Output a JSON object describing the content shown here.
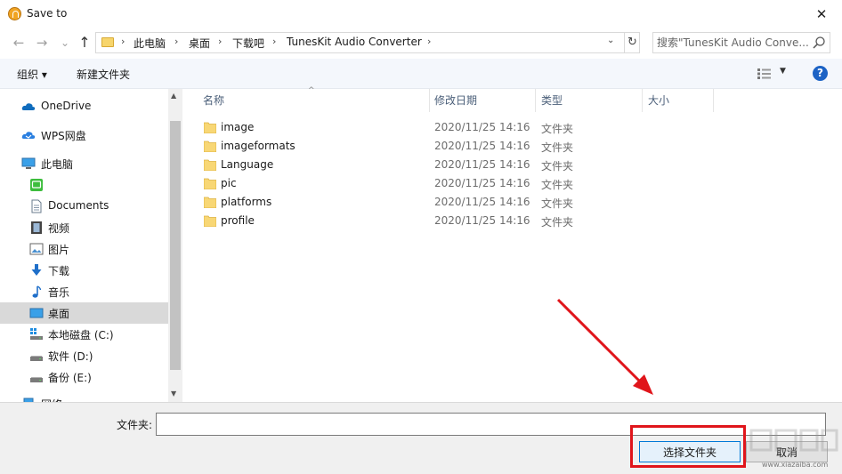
{
  "window": {
    "title": "Save to",
    "close_glyph": "✕"
  },
  "navigation": {
    "back_glyph": "←",
    "forward_glyph": "→",
    "recent_glyph": "⌄",
    "up_glyph": "↑",
    "breadcrumbs": [
      "此电脑",
      "桌面",
      "下载吧",
      "TunesKit Audio Converter"
    ],
    "crumb_separator": "›",
    "dropdown_glyph": "⌄",
    "refresh_glyph": "↻",
    "search_placeholder": "搜索\"TunesKit Audio Conve..."
  },
  "toolbar": {
    "organize_label": "组织 ▾",
    "new_folder_label": "新建文件夹",
    "view_dropdown_glyph": "▼",
    "help_label": "?"
  },
  "sidebar": {
    "items": [
      {
        "label": "OneDrive",
        "icon": "cloud-icon"
      },
      {
        "label": "WPS网盘",
        "icon": "wps-cloud-icon"
      },
      {
        "label": "此电脑",
        "icon": "computer-icon"
      },
      {
        "label": "",
        "icon": "wechat-files-icon"
      },
      {
        "label": "Documents",
        "icon": "document-icon"
      },
      {
        "label": "视频",
        "icon": "video-icon"
      },
      {
        "label": "图片",
        "icon": "picture-icon"
      },
      {
        "label": "下载",
        "icon": "download-icon"
      },
      {
        "label": "音乐",
        "icon": "music-icon"
      },
      {
        "label": "桌面",
        "icon": "desktop-icon",
        "selected": true
      },
      {
        "label": "本地磁盘 (C:)",
        "icon": "system-drive-icon"
      },
      {
        "label": "软件 (D:)",
        "icon": "drive-icon"
      },
      {
        "label": "备份 (E:)",
        "icon": "drive-icon"
      },
      {
        "label": "网络",
        "icon": "network-icon"
      }
    ],
    "scroll_up_glyph": "▲",
    "scroll_down_glyph": "▼"
  },
  "file_list": {
    "columns": [
      "名称",
      "修改日期",
      "类型",
      "大小"
    ],
    "sort_glyph": "^",
    "rows": [
      {
        "name": "image",
        "date": "2020/11/25 14:16",
        "type": "文件夹"
      },
      {
        "name": "imageformats",
        "date": "2020/11/25 14:16",
        "type": "文件夹"
      },
      {
        "name": "Language",
        "date": "2020/11/25 14:16",
        "type": "文件夹"
      },
      {
        "name": "pic",
        "date": "2020/11/25 14:16",
        "type": "文件夹"
      },
      {
        "name": "platforms",
        "date": "2020/11/25 14:16",
        "type": "文件夹"
      },
      {
        "name": "profile",
        "date": "2020/11/25 14:16",
        "type": "文件夹"
      }
    ]
  },
  "footer": {
    "folder_label": "文件夹:",
    "folder_value": "",
    "select_button": "选择文件夹",
    "cancel_button": "取消"
  },
  "annotation": {
    "arrow_color": "#e0151b",
    "box_color": "#e0151b"
  },
  "watermark": {
    "text": "www.xiazaiba.com"
  }
}
